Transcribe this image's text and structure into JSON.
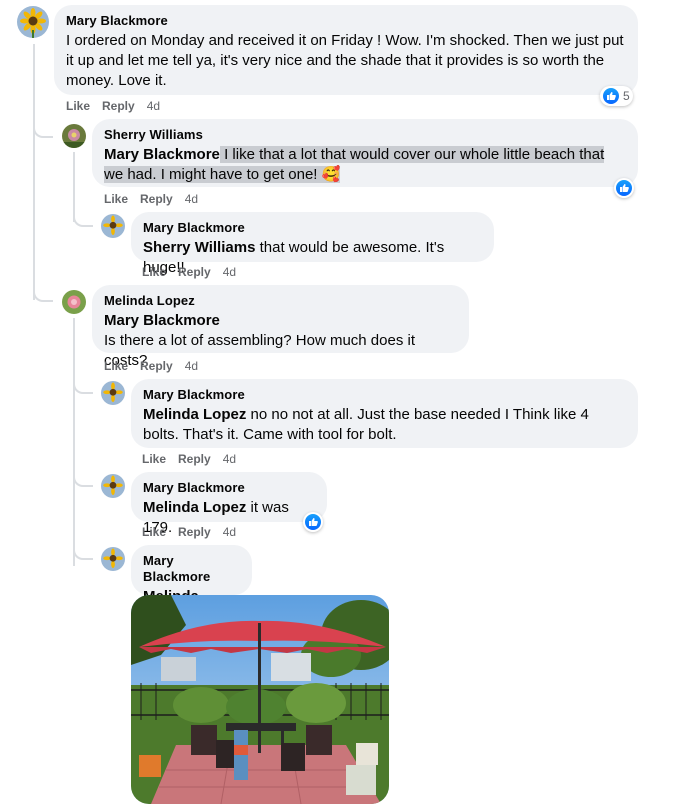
{
  "comments": [
    {
      "author": "Mary Blackmore",
      "text": "I ordered on Monday and received it on Friday ! Wow. I'm shocked. Then we just put it up and let me tell ya, it's very nice and the shade that it provides is so worth the money. Love it.",
      "like": "Like",
      "reply": "Reply",
      "time": "4d",
      "reaction_count": "5"
    },
    {
      "author": "Sherry Williams",
      "mention": "Mary Blackmore",
      "text": " I like that a lot that would cover our whole little beach that we had. I might have to get one! 🥰",
      "like": "Like",
      "reply": "Reply",
      "time": "4d"
    },
    {
      "author": "Mary Blackmore",
      "mention": "Sherry Williams",
      "text": " that would be awesome. It's huge!!",
      "like": "Like",
      "reply": "Reply",
      "time": "4d"
    },
    {
      "author": "Melinda Lopez",
      "mention": "Mary Blackmore",
      "text": "Is there a lot of assembling? How much does it costs?",
      "like": "Like",
      "reply": "Reply",
      "time": "4d"
    },
    {
      "author": "Mary Blackmore",
      "mention": "Melinda Lopez",
      "text": " no no not at all. Just the base needed I Think like 4 bolts. That's it. Came with tool for bolt.",
      "like": "Like",
      "reply": "Reply",
      "time": "4d"
    },
    {
      "author": "Mary Blackmore",
      "mention": "Melinda Lopez",
      "text": " it was 179.",
      "like": "Like",
      "reply": "Reply",
      "time": "4d"
    },
    {
      "author": "Mary Blackmore",
      "mention": "Melinda Lopez"
    }
  ],
  "colors": {
    "bubble": "#f0f2f5",
    "like_blue": "#0866ff",
    "meta_gray": "#65676b",
    "umbrella_red": "#d9424f"
  },
  "icons": [
    "sunflower-avatar",
    "flower-avatar",
    "rose-avatar",
    "like-reaction-icon"
  ]
}
